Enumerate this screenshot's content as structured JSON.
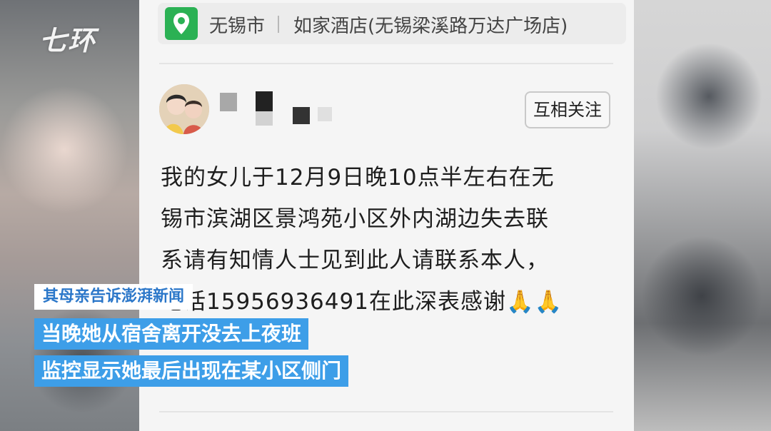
{
  "watermark": {
    "text": "七环"
  },
  "location": {
    "icon": "map-pin-icon",
    "city": "无锡市",
    "place": "如家酒店(无锡梁溪路万达广场店)"
  },
  "post": {
    "author_avatar": "avatar-photo",
    "follow_label": "互相关注",
    "lines": [
      "我的女儿于12月9日晚10点半左右在无",
      "锡市滨湖区景鸿苑小区外内湖边失去联",
      "系请有知情人士见到此人请联系本人，",
      "电话15956936491在此深表感谢🙏🙏"
    ]
  },
  "captions": {
    "source": "其母亲告诉澎湃新闻",
    "line1": "当晚她从宿舍离开没去上夜班",
    "line2": "监控显示她最后出现在某小区侧门"
  },
  "colors": {
    "caption_bg": "#3d9ee8",
    "pin_green": "#2bb154"
  }
}
